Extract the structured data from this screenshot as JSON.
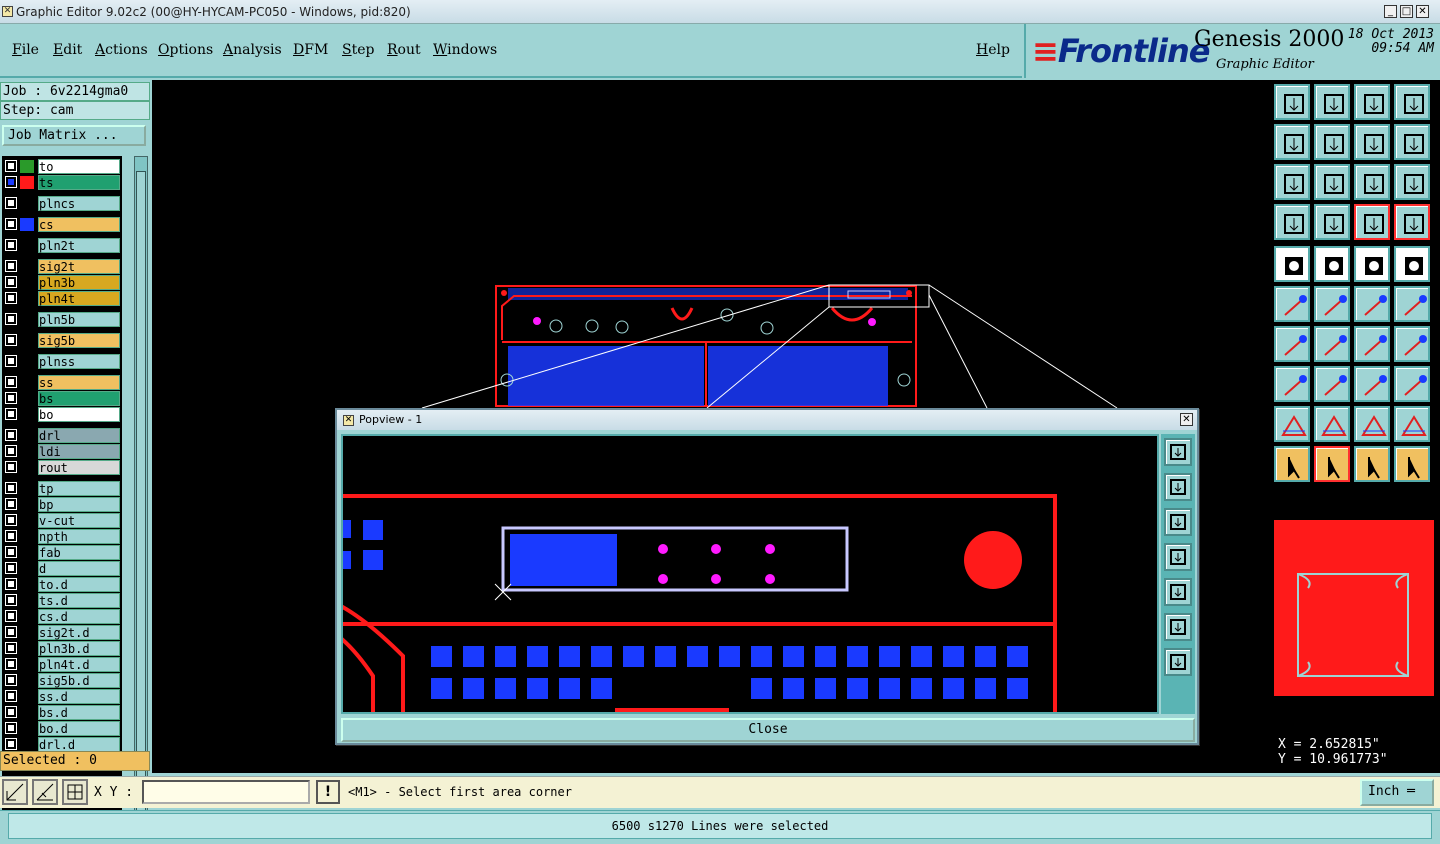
{
  "window": {
    "title": "Graphic Editor 9.02c2 (00@HY-HYCAM-PC050 - Windows, pid:820)"
  },
  "menu": {
    "items": [
      "File",
      "Edit",
      "Actions",
      "Options",
      "Analysis",
      "DFM",
      "Step",
      "Rout",
      "Windows"
    ],
    "help": "Help"
  },
  "logo": {
    "brand": "Frontline",
    "product": "Genesis 2000",
    "subtitle": "Graphic Editor",
    "date": "18 Oct 2013",
    "time": "09:54 AM"
  },
  "job": {
    "job_line": "Job : 6v2214gma0",
    "step_line": "Step: cam",
    "job_matrix": "Job Matrix ..."
  },
  "layers": [
    {
      "name": "to",
      "c1": "#2a9a2a",
      "c2": "#000000",
      "bg": "#ffffff"
    },
    {
      "name": "ts",
      "c1": "#ff1a1a",
      "c2": "#000000",
      "bg": "#20a070"
    },
    {
      "name": "plncs",
      "c1": "#000000",
      "c2": "#000000",
      "bg": "#9fd4d4"
    },
    {
      "name": "cs",
      "c1": "#1a3aff",
      "c2": "#000000",
      "bg": "#f0c060"
    },
    {
      "name": "pln2t",
      "c1": "#000000",
      "c2": "#000000",
      "bg": "#9fd4d4"
    },
    {
      "name": "sig2t",
      "c1": "#000000",
      "c2": "#000000",
      "bg": "#f0c060"
    },
    {
      "name": "pln3b",
      "c1": "#000000",
      "c2": "#000000",
      "bg": "#d8a820"
    },
    {
      "name": "pln4t",
      "c1": "#000000",
      "c2": "#000000",
      "bg": "#d8a820"
    },
    {
      "name": "pln5b",
      "c1": "#000000",
      "c2": "#000000",
      "bg": "#9fd4d4"
    },
    {
      "name": "sig5b",
      "c1": "#000000",
      "c2": "#000000",
      "bg": "#f0c060"
    },
    {
      "name": "plnss",
      "c1": "#000000",
      "c2": "#000000",
      "bg": "#9fd4d4"
    },
    {
      "name": "ss",
      "c1": "#000000",
      "c2": "#000000",
      "bg": "#f0c060"
    },
    {
      "name": "bs",
      "c1": "#000000",
      "c2": "#000000",
      "bg": "#20a070"
    },
    {
      "name": "bo",
      "c1": "#000000",
      "c2": "#000000",
      "bg": "#ffffff"
    },
    {
      "name": "drl",
      "c1": "#000000",
      "c2": "#000000",
      "bg": "#8aa8b0"
    },
    {
      "name": "ldi",
      "c1": "#000000",
      "c2": "#000000",
      "bg": "#8aa8b0"
    },
    {
      "name": "rout",
      "c1": "#000000",
      "c2": "#000000",
      "bg": "#d8d8d8"
    },
    {
      "name": "tp",
      "c1": "#000000",
      "c2": "#000000",
      "bg": "#9fd4d4"
    },
    {
      "name": "bp",
      "c1": "#000000",
      "c2": "#000000",
      "bg": "#9fd4d4"
    },
    {
      "name": "v-cut",
      "c1": "#000000",
      "c2": "#000000",
      "bg": "#9fd4d4"
    },
    {
      "name": "npth",
      "c1": "#000000",
      "c2": "#000000",
      "bg": "#9fd4d4"
    },
    {
      "name": "fab",
      "c1": "#000000",
      "c2": "#000000",
      "bg": "#9fd4d4"
    },
    {
      "name": "d",
      "c1": "#000000",
      "c2": "#000000",
      "bg": "#9fd4d4"
    },
    {
      "name": "to.d",
      "c1": "#000000",
      "c2": "#000000",
      "bg": "#9fd4d4"
    },
    {
      "name": "ts.d",
      "c1": "#000000",
      "c2": "#000000",
      "bg": "#9fd4d4"
    },
    {
      "name": "cs.d",
      "c1": "#000000",
      "c2": "#000000",
      "bg": "#9fd4d4"
    },
    {
      "name": "sig2t.d",
      "c1": "#000000",
      "c2": "#000000",
      "bg": "#9fd4d4"
    },
    {
      "name": "pln3b.d",
      "c1": "#000000",
      "c2": "#000000",
      "bg": "#9fd4d4"
    },
    {
      "name": "pln4t.d",
      "c1": "#000000",
      "c2": "#000000",
      "bg": "#9fd4d4"
    },
    {
      "name": "sig5b.d",
      "c1": "#000000",
      "c2": "#000000",
      "bg": "#9fd4d4"
    },
    {
      "name": "ss.d",
      "c1": "#000000",
      "c2": "#000000",
      "bg": "#9fd4d4"
    },
    {
      "name": "bs.d",
      "c1": "#000000",
      "c2": "#000000",
      "bg": "#9fd4d4"
    },
    {
      "name": "bo.d",
      "c1": "#000000",
      "c2": "#000000",
      "bg": "#9fd4d4"
    },
    {
      "name": "drl.d",
      "c1": "#000000",
      "c2": "#000000",
      "bg": "#9fd4d4"
    }
  ],
  "selected": "Selected : 0",
  "popview": {
    "title": "Popview - 1",
    "close_label": "Close"
  },
  "coords": {
    "x": "X = 2.652815\"",
    "y": "Y = 10.961773\""
  },
  "cmdbar": {
    "xy_label": "X Y :",
    "xy_value": "",
    "bang": "!",
    "prompt": "<M1> - Select first area corner",
    "units": "Inch"
  },
  "status": "6500 s1270 Lines were selected",
  "colors": {
    "bg": "#9fd4d4",
    "red": "#ff1a1a",
    "blue": "#1a3aff",
    "magenta": "#ff1aff",
    "outline": "#c8c8ff"
  }
}
